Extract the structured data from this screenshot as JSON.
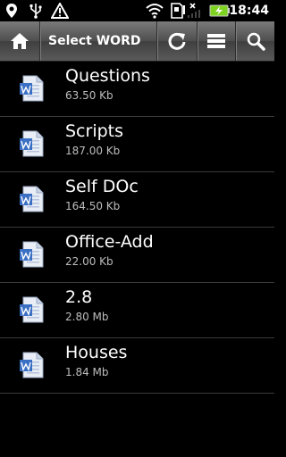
{
  "status_bar": {
    "time": "18:44",
    "icons": [
      "location-pin-icon",
      "usb-icon",
      "warning-icon",
      "wifi-icon",
      "sd-card-icon",
      "signal-off-icon",
      "battery-charging-icon"
    ]
  },
  "action_bar": {
    "title": "Select WORD",
    "buttons": [
      "home-icon",
      "refresh-icon",
      "menu-list-icon",
      "search-icon"
    ]
  },
  "files": [
    {
      "name": "Questions",
      "size": "63.50 Kb"
    },
    {
      "name": "Scripts",
      "size": "187.00 Kb"
    },
    {
      "name": "Self DOc",
      "size": "164.50 Kb"
    },
    {
      "name": "Office-Add",
      "size": "22.00 Kb"
    },
    {
      "name": "2.8",
      "size": "2.80 Mb"
    },
    {
      "name": "Houses",
      "size": "1.84 Mb"
    }
  ],
  "colors": {
    "background": "#000000",
    "action_bar": "#5a5a5a",
    "battery": "#7ed321",
    "doc_icon_blue": "#3a6fc4"
  }
}
